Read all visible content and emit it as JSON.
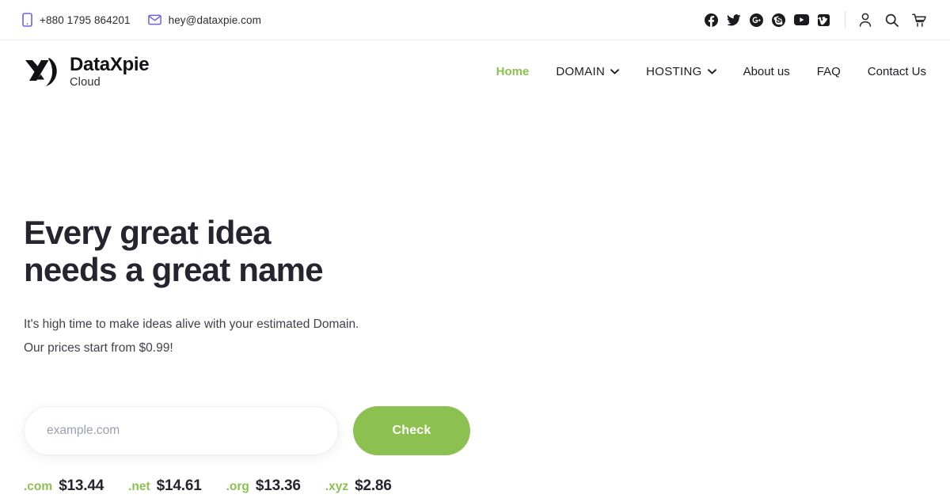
{
  "topbar": {
    "phone": "+880 1795 864201",
    "email": "hey@dataxpie.com",
    "phone_icon": "mobile-phone-icon",
    "email_icon": "envelope-icon",
    "social": [
      {
        "name": "facebook",
        "label": "Facebook"
      },
      {
        "name": "twitter",
        "label": "Twitter"
      },
      {
        "name": "google-plus",
        "label": "Google Plus"
      },
      {
        "name": "skype",
        "label": "Skype"
      },
      {
        "name": "youtube",
        "label": "YouTube"
      },
      {
        "name": "vimeo",
        "label": "Vimeo"
      }
    ],
    "utils": [
      {
        "name": "user",
        "label": "Account"
      },
      {
        "name": "search",
        "label": "Search"
      },
      {
        "name": "cart",
        "label": "Cart"
      }
    ]
  },
  "brand": {
    "name": "DataXpie",
    "tagline": "Cloud"
  },
  "nav": {
    "items": [
      {
        "label": "Home",
        "active": true,
        "dropdown": false
      },
      {
        "label": "DOMAIN",
        "active": false,
        "dropdown": true
      },
      {
        "label": "HOSTING",
        "active": false,
        "dropdown": true
      },
      {
        "label": "About us",
        "active": false,
        "dropdown": false
      },
      {
        "label": "FAQ",
        "active": false,
        "dropdown": false
      },
      {
        "label": "Contact Us",
        "active": false,
        "dropdown": false
      }
    ]
  },
  "hero": {
    "title": "Every great idea\nneeds a great name",
    "subtitle": "It's high time to make ideas alive with your estimated Domain. Our prices start from $0.99!",
    "search_placeholder": "example.com",
    "search_value": "",
    "check_label": "Check",
    "tlds": [
      {
        "name": ".com",
        "price": "$13.44"
      },
      {
        "name": ".net",
        "price": "$14.61"
      },
      {
        "name": ".org",
        "price": "$13.36"
      },
      {
        "name": ".xyz",
        "price": "$2.86"
      }
    ]
  },
  "colors": {
    "accent_green": "#8cc152",
    "heading_dark": "#26242f",
    "icon_purple": "#6c63e0"
  }
}
